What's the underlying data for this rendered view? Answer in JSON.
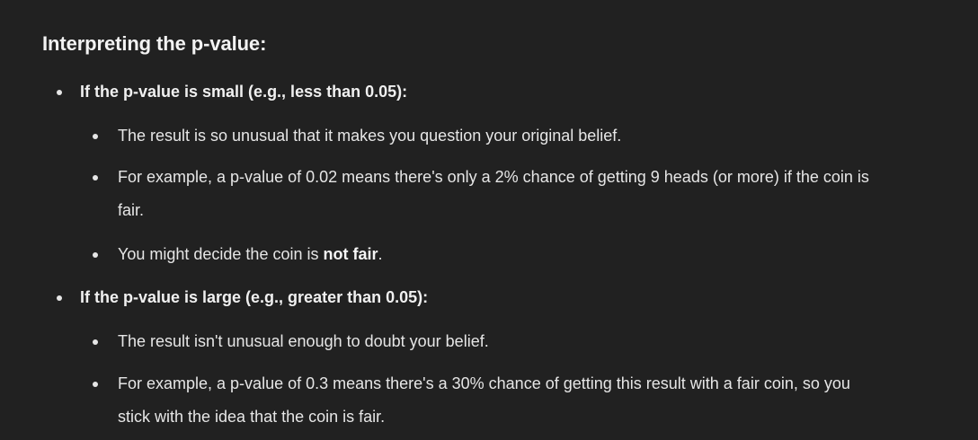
{
  "heading": "Interpreting the p-value:",
  "small": {
    "title": "If the p-value is small (e.g., less than 0.05):",
    "b1": "The result is so unusual that it makes you question your original belief.",
    "b2": "For example, a p-value of 0.02 means there's only a 2% chance of getting 9 heads (or more) if the coin is fair.",
    "b3_pre": "You might decide the coin is ",
    "b3_bold": "not fair",
    "b3_post": "."
  },
  "large": {
    "title": "If the p-value is large (e.g., greater than 0.05):",
    "b1": "The result isn't unusual enough to doubt your belief.",
    "b2": "For example, a p-value of 0.3 means there's a 30% chance of getting this result with a fair coin, so you stick with the idea that the coin is fair."
  }
}
